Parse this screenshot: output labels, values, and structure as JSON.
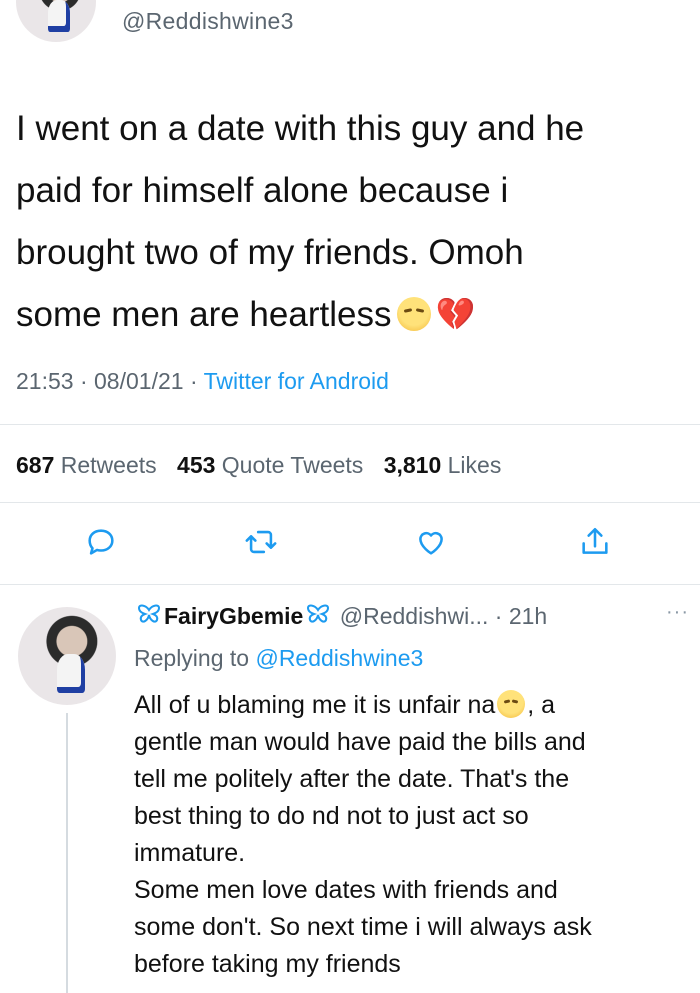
{
  "tweet": {
    "handle": "@Reddishwine3",
    "text_lines": [
      "I went on a date with this guy and he",
      "paid for himself alone because i",
      "brought two of my friends. Omoh",
      "some men are heartless"
    ],
    "emojis": [
      "unamused-face-emoji",
      "broken-heart-emoji"
    ],
    "time": "21:53",
    "date": "08/01/21",
    "separator": "·",
    "source": "Twitter for Android",
    "retweets_count": "687",
    "retweets_label": "Retweets",
    "quotes_count": "453",
    "quotes_label": "Quote Tweets",
    "likes_count": "3,810",
    "likes_label": "Likes",
    "actions": [
      "reply-icon",
      "retweet-icon",
      "like-icon",
      "share-icon"
    ]
  },
  "reply": {
    "display_name": "FairyGbemie",
    "handle": "@Reddishwi...",
    "time_ago": "21h",
    "separator": "·",
    "more": "···",
    "replying_prefix": "Replying to",
    "replying_to": "@Reddishwine3",
    "line1_before_emoji": "All of u blaming me it is unfair na",
    "line1_after_emoji": ", a",
    "text_lines": [
      "gentle man would have paid the bills and",
      "tell me politely after the date. That's the",
      "best thing to do nd not to just act so",
      "immature.",
      "Some men love dates with friends and",
      "some don't. So next time i will always ask",
      "before taking my friends"
    ]
  },
  "colors": {
    "accent": "#1d9bf0",
    "secondary_text": "#5b6670",
    "divider": "#e3e7ea"
  }
}
